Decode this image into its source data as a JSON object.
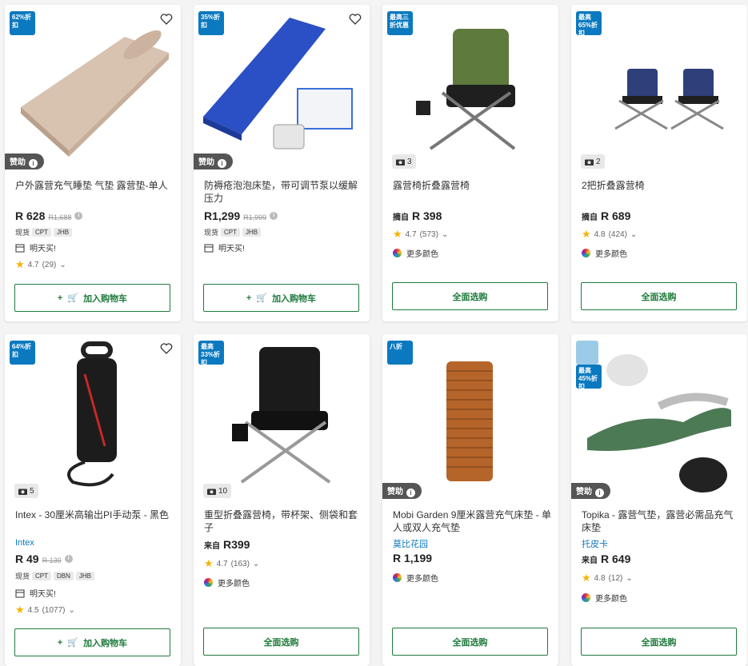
{
  "products": [
    {
      "discount": "62%折\n扣",
      "sponsored": "赞助",
      "photos": "",
      "title": "户外露营充气睡垫 气垫 露营垫-单人",
      "brand": "",
      "price_prefix": "",
      "price": "R 628",
      "old_price": "R1,688",
      "stock_label": "现货",
      "stock_tags": [
        "CPT",
        "JHB"
      ],
      "delivery": "明天买!",
      "rating": "4.7",
      "reviews": "(29)",
      "more_colors": "",
      "button": "加入购物车"
    },
    {
      "discount": "35%折\n扣",
      "sponsored": "赞助",
      "photos": "",
      "title": "防褥疮泡泡床垫，带可调节泵以缓解压力",
      "brand": "",
      "price_prefix": "",
      "price": "R1,299",
      "old_price": "R1,999",
      "stock_label": "现货",
      "stock_tags": [
        "CPT",
        "JHB"
      ],
      "delivery": "明天买!",
      "rating": "",
      "reviews": "",
      "more_colors": "",
      "button": "加入购物车"
    },
    {
      "discount": "最高三\n折优惠",
      "sponsored": "",
      "photos": "3",
      "title": "露营椅折叠露营椅",
      "brand": "",
      "price_prefix": "摘自",
      "price": "R 398",
      "old_price": "",
      "stock_label": "",
      "stock_tags": [],
      "delivery": "",
      "rating": "4.7",
      "reviews": "(573)",
      "more_colors": "更多颜色",
      "button": "全面选购"
    },
    {
      "discount": "最高\n65%折\n扣",
      "sponsored": "",
      "photos": "2",
      "title": "2把折叠露营椅",
      "brand": "",
      "price_prefix": "摘自",
      "price": "R 689",
      "old_price": "",
      "stock_label": "",
      "stock_tags": [],
      "delivery": "",
      "rating": "4.8",
      "reviews": "(424)",
      "more_colors": "更多颜色",
      "button": "全面选购"
    },
    {
      "discount": "64%折\n扣",
      "sponsored": "",
      "photos": "5",
      "title": "Intex - 30厘米高输出PI手动泵 - 黑色",
      "brand": "Intex",
      "price_prefix": "",
      "price": "R 49",
      "old_price": "R 139",
      "stock_label": "现货",
      "stock_tags": [
        "CPT",
        "DBN",
        "JHB"
      ],
      "delivery": "明天买!",
      "rating": "4.5",
      "reviews": "(1077)",
      "more_colors": "",
      "button": "加入购物车"
    },
    {
      "discount": "最高\n33%折\n扣",
      "sponsored": "",
      "photos": "10",
      "title": "重型折叠露营椅，带杯架、侧袋和套子",
      "brand": "",
      "price_prefix": "来自",
      "price": "R399",
      "old_price": "",
      "stock_label": "",
      "stock_tags": [],
      "delivery": "",
      "rating": "4.7",
      "reviews": "(163)",
      "more_colors": "更多颜色",
      "button": "全面选购"
    },
    {
      "discount": "八折",
      "sponsored": "赞助",
      "photos": "",
      "title": "Mobi Garden 9厘米露营充气床垫 - 单人或双人充气垫",
      "brand": "莫比花园",
      "price_prefix": "",
      "price": "R 1,199",
      "old_price": "",
      "stock_label": "",
      "stock_tags": [],
      "delivery": "",
      "rating": "",
      "reviews": "",
      "more_colors": "更多颜色",
      "button": "全面选购"
    },
    {
      "discount": "最高\n45%折\n扣",
      "sponsored": "赞助",
      "photos": "",
      "title": "Topika - 露营气垫，露营必需品充气床垫",
      "brand": "托皮卡",
      "price_prefix": "来自",
      "price": "R 649",
      "old_price": "",
      "stock_label": "",
      "stock_tags": [],
      "delivery": "",
      "rating": "4.8",
      "reviews": "(12)",
      "more_colors": "更多颜色",
      "button": "全面选购"
    }
  ],
  "colors": {
    "accent_green": "#1f7a3c",
    "badge_blue": "#0b79bf",
    "star": "#f5b301",
    "sponsored_bg": "#555555"
  },
  "icons": {
    "wishlist": "heart-icon",
    "info": "info-icon",
    "camera": "camera-icon",
    "calendar": "calendar-icon",
    "cart": "cart-icon",
    "chevron": "chevron-down-icon",
    "colors": "color-wheel-icon"
  }
}
